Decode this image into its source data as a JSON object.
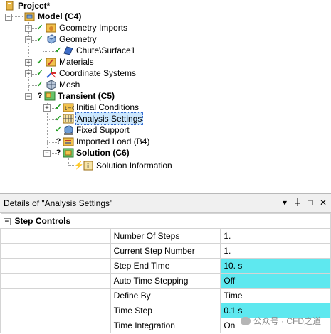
{
  "tree": {
    "project": "Project*",
    "model": "Model (C4)",
    "geometry_imports": "Geometry Imports",
    "geometry": "Geometry",
    "chute_surface": "Chute\\Surface1",
    "materials": "Materials",
    "coordinate_systems": "Coordinate Systems",
    "mesh": "Mesh",
    "transient": "Transient (C5)",
    "initial_conditions": "Initial Conditions",
    "analysis_settings": "Analysis Settings",
    "fixed_support": "Fixed Support",
    "imported_load": "Imported Load (B4)",
    "solution": "Solution (C6)",
    "solution_information": "Solution Information"
  },
  "details": {
    "title": "Details of \"Analysis Settings\"",
    "buttons": {
      "dropdown": "▾",
      "pin": "⊥",
      "restore": "□",
      "close": "✕"
    },
    "category": "Step Controls",
    "rows": [
      {
        "name": "Number Of Steps",
        "value": "1.",
        "highlight": false
      },
      {
        "name": "Current Step Number",
        "value": "1.",
        "highlight": false
      },
      {
        "name": "Step End Time",
        "value": "10. s",
        "highlight": true
      },
      {
        "name": "Auto Time Stepping",
        "value": "Off",
        "highlight": true
      },
      {
        "name": "Define By",
        "value": "Time",
        "highlight": false
      },
      {
        "name": "Time Step",
        "value": "0.1 s",
        "highlight": true
      },
      {
        "name": "Time Integration",
        "value": "On",
        "highlight": false
      }
    ],
    "highlight_color": "#5ee8ef"
  },
  "watermark": "公众号 · CFD之道"
}
